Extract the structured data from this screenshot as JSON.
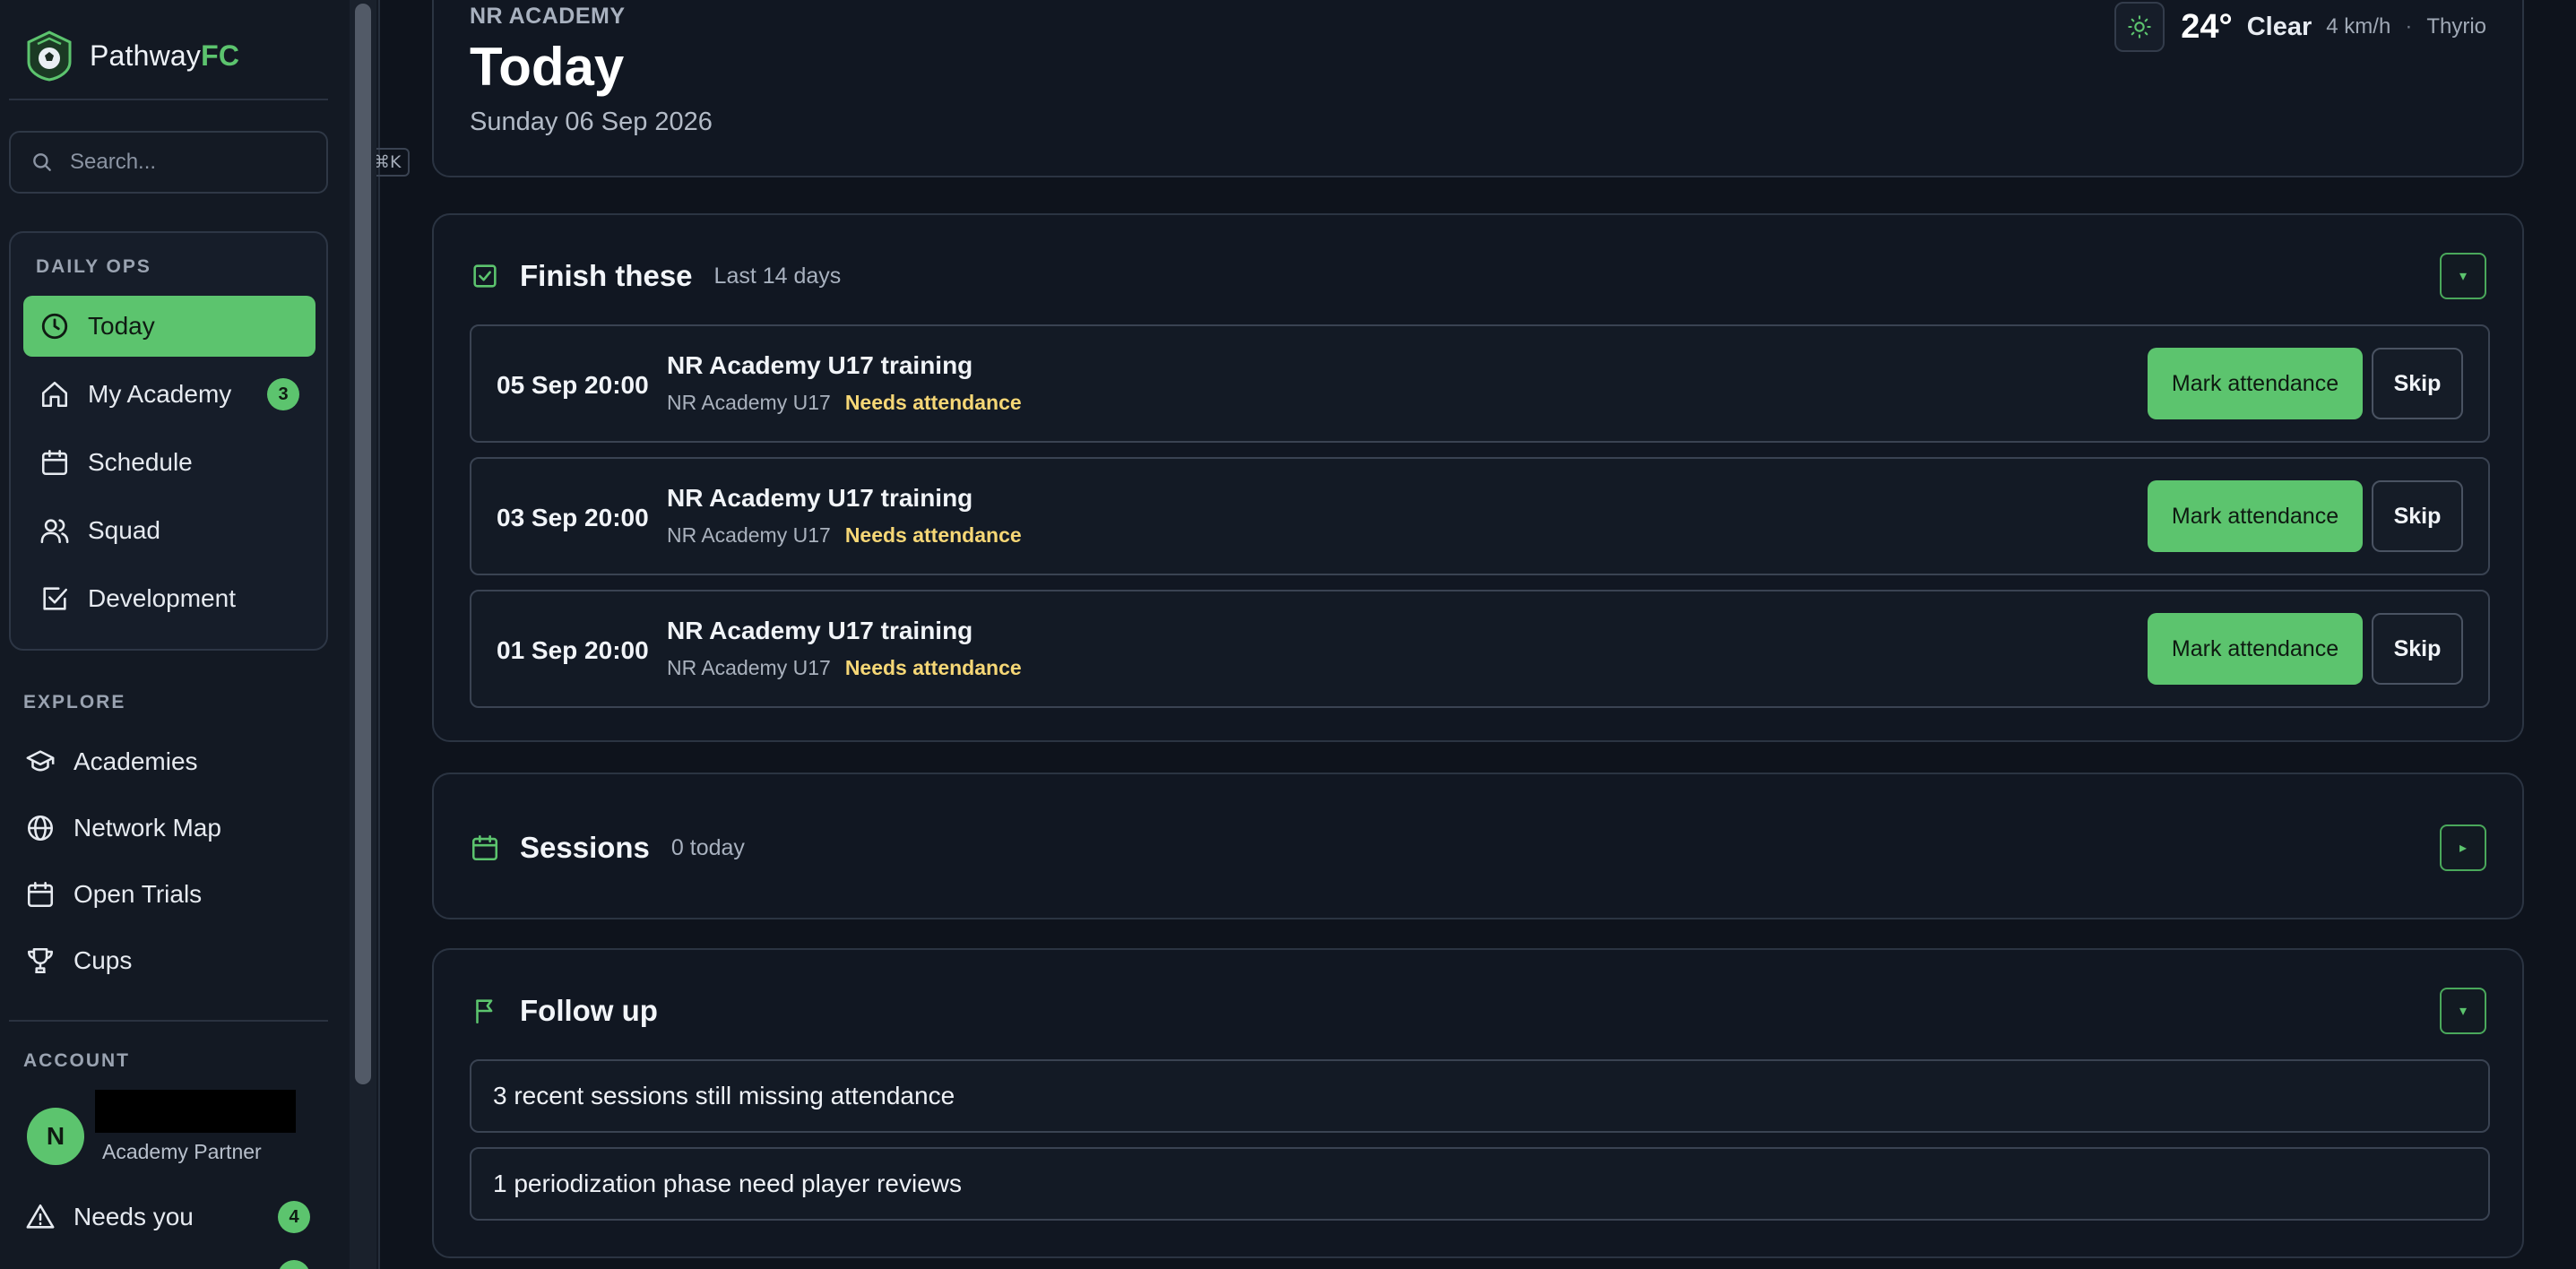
{
  "sidebar": {
    "brand": {
      "name_main": "Pathway",
      "name_accent": "FC"
    },
    "search": {
      "placeholder": "Search...",
      "shortcut": "⌘K"
    },
    "daily_ops": {
      "heading": "DAILY OPS",
      "items": [
        {
          "label": "Today",
          "icon": "clock-icon",
          "active": true
        },
        {
          "label": "My Academy",
          "icon": "home-icon",
          "badge": "3"
        },
        {
          "label": "Schedule",
          "icon": "calendar-icon"
        },
        {
          "label": "Squad",
          "icon": "users-icon"
        },
        {
          "label": "Development",
          "icon": "checkbox-icon"
        }
      ]
    },
    "explore": {
      "heading": "EXPLORE",
      "items": [
        {
          "label": "Academies",
          "icon": "graduation-cap-icon"
        },
        {
          "label": "Network Map",
          "icon": "globe-icon"
        },
        {
          "label": "Open Trials",
          "icon": "calendar-icon"
        },
        {
          "label": "Cups",
          "icon": "trophy-icon"
        }
      ]
    },
    "account": {
      "heading": "ACCOUNT",
      "avatar_initial": "N",
      "role": "Academy Partner",
      "needs_you": {
        "label": "Needs you",
        "badge": "4",
        "icon": "alert-triangle-icon"
      }
    }
  },
  "header": {
    "eyebrow": "NR ACADEMY",
    "title": "Today",
    "date": "Sunday 06 Sep 2026",
    "weather": {
      "icon": "sun-icon",
      "temp": "24°",
      "condition": "Clear",
      "wind": "4 km/h",
      "separator": "·",
      "location": "Thyrio"
    }
  },
  "finish_these": {
    "title": "Finish these",
    "subtitle": "Last 14 days",
    "toggle": "▾",
    "rows": [
      {
        "time": "05 Sep 20:00",
        "title": "NR Academy U17 training",
        "team": "NR Academy U17",
        "status": "Needs attendance",
        "primary": "Mark attendance",
        "secondary": "Skip"
      },
      {
        "time": "03 Sep 20:00",
        "title": "NR Academy U17 training",
        "team": "NR Academy U17",
        "status": "Needs attendance",
        "primary": "Mark attendance",
        "secondary": "Skip"
      },
      {
        "time": "01 Sep 20:00",
        "title": "NR Academy U17 training",
        "team": "NR Academy U17",
        "status": "Needs attendance",
        "primary": "Mark attendance",
        "secondary": "Skip"
      }
    ]
  },
  "sessions": {
    "title": "Sessions",
    "subtitle": "0 today",
    "toggle": "▸"
  },
  "follow_up": {
    "title": "Follow up",
    "toggle": "▾",
    "items": [
      "3 recent sessions still missing attendance",
      "1 periodization phase need player reviews"
    ]
  },
  "colors": {
    "accent": "#5cc46e",
    "warning": "#f6d776",
    "background": "#0e131c",
    "card": "#111722"
  }
}
